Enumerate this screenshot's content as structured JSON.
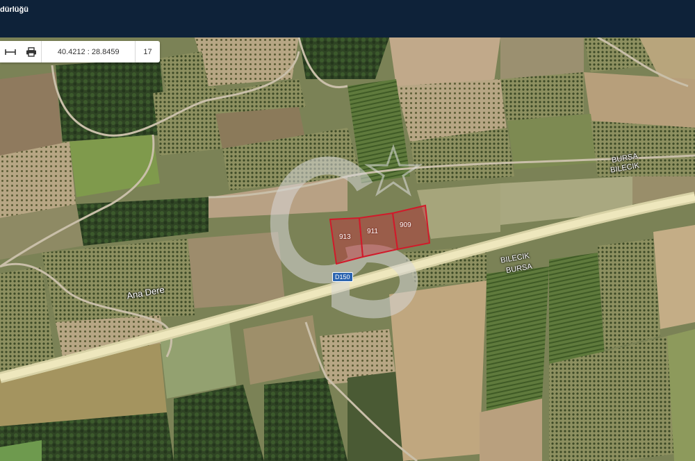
{
  "header": {
    "title": "dürlüğü"
  },
  "toolbar": {
    "measure_icon": "measure-icon",
    "print_icon": "print-icon",
    "coordinates": "40.4212 : 28.8459",
    "zoom": "17"
  },
  "map": {
    "place_labels": {
      "bursa_top": "BURSA",
      "bilecik_top": "BILECIK",
      "bilecik_bottom": "BILECIK",
      "bursa_bottom": "BURSA",
      "river": "Ana Dere"
    },
    "road_badge": "D150",
    "parcels": [
      "913",
      "911",
      "909"
    ],
    "watermark": "GB",
    "colors": {
      "header": "#0e2239",
      "parcel_outline": "#d11a2a",
      "parcel_fill": "#c0303c"
    }
  }
}
